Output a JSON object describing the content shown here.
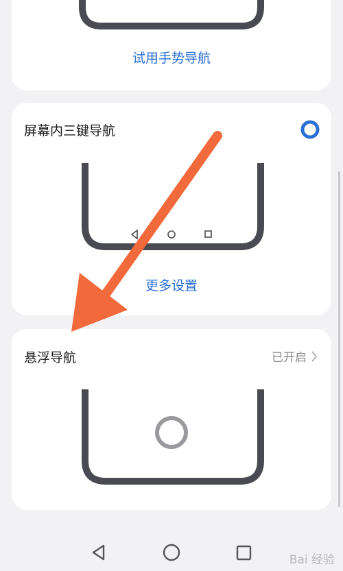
{
  "gesture_card": {
    "link": "试用手势导航"
  },
  "three_key_card": {
    "title": "屏幕内三键导航",
    "link": "更多设置",
    "selected": true
  },
  "float_card": {
    "title": "悬浮导航",
    "status": "已开启"
  },
  "icons": {
    "radio": "radio-selected-icon",
    "chevron": "chevron-right-icon",
    "back": "back-triangle-icon",
    "home": "home-circle-icon",
    "recent": "recent-square-icon"
  },
  "watermark": "Bai 经验",
  "colors": {
    "accent": "#2a6fd6",
    "arrow": "#f26a3c",
    "phone_frame": "#4a4a52"
  }
}
